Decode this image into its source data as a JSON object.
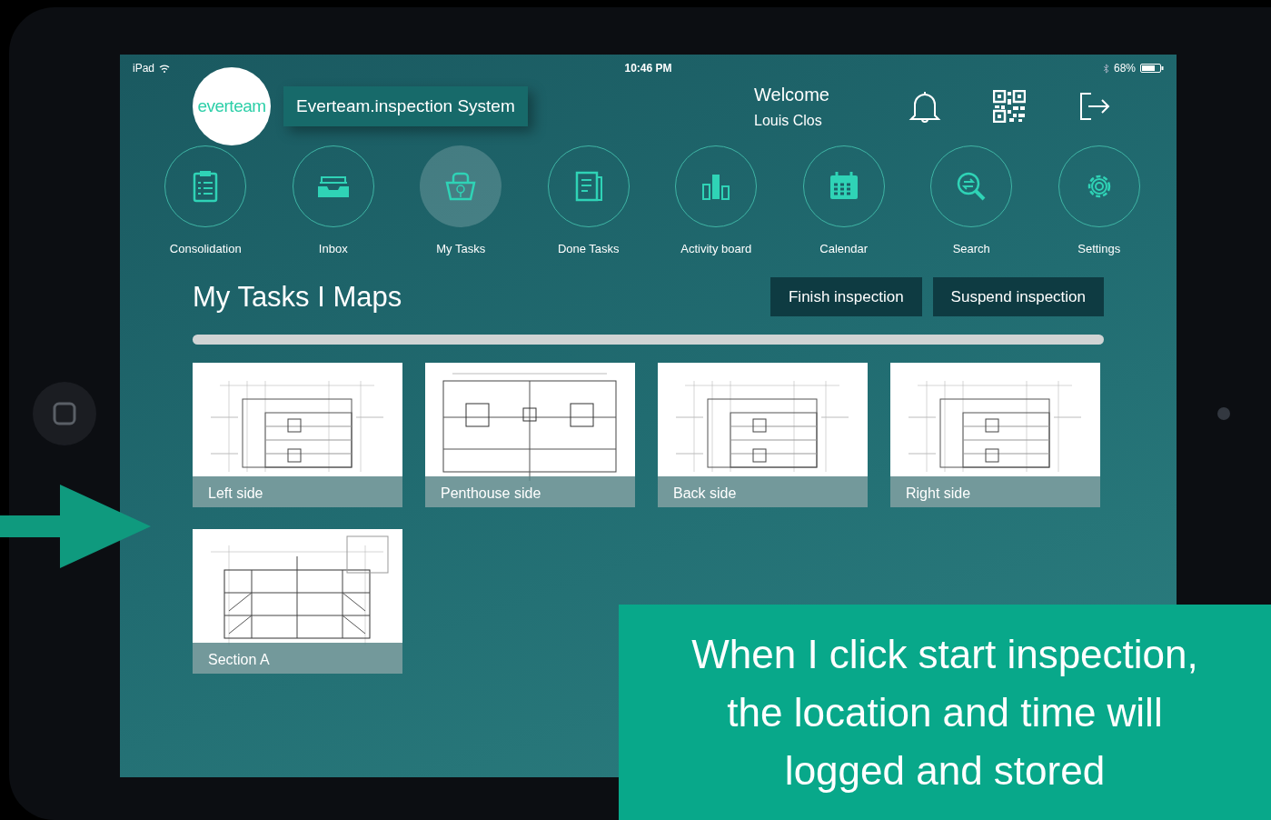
{
  "status_bar": {
    "device": "iPad",
    "time": "10:46 PM",
    "battery": "68%"
  },
  "header": {
    "logo": "everteam",
    "app_title": "Everteam.inspection System",
    "welcome": "Welcome",
    "user": "Louis Clos"
  },
  "nav": [
    {
      "label": "Consolidation",
      "kind": "clipboard",
      "selected": false
    },
    {
      "label": "Inbox",
      "kind": "tray",
      "selected": false
    },
    {
      "label": "My Tasks",
      "kind": "basket",
      "selected": true
    },
    {
      "label": "Done Tasks",
      "kind": "document",
      "selected": false
    },
    {
      "label": "Activity board",
      "kind": "bars",
      "selected": false
    },
    {
      "label": "Calendar",
      "kind": "calendar",
      "selected": false
    },
    {
      "label": "Search",
      "kind": "search",
      "selected": false
    },
    {
      "label": "Settings",
      "kind": "gear",
      "selected": false
    }
  ],
  "page_title": "My Tasks I Maps",
  "actions": [
    "Finish inspection",
    "Suspend inspection"
  ],
  "progress": {
    "level": 1
  },
  "maps": [
    {
      "label": "Left side",
      "kind": "elevation"
    },
    {
      "label": "Penthouse side",
      "kind": "plan"
    },
    {
      "label": "Back side",
      "kind": "elevation"
    },
    {
      "label": "Right side",
      "kind": "elevation"
    },
    {
      "label": "Section A",
      "kind": "section"
    }
  ],
  "callout": "When I click start inspection, the location and time will logged and stored"
}
